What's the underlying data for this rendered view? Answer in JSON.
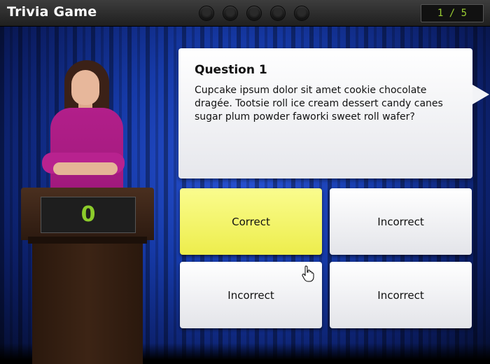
{
  "header": {
    "title": "Trivia Game",
    "progress_dots": 5,
    "counter": "1 / 5"
  },
  "podium": {
    "score": "0"
  },
  "question": {
    "title": "Question 1",
    "text": "Cupcake ipsum dolor sit amet cookie chocolate dragée. Tootsie roll ice cream dessert candy canes sugar plum powder faworki sweet roll wafer?"
  },
  "answers": [
    {
      "label": "Correct",
      "state": "selected"
    },
    {
      "label": "Incorrect"
    },
    {
      "label": "Incorrect"
    },
    {
      "label": "Incorrect"
    }
  ],
  "colors": {
    "selected_answer": "#f3f36a",
    "score": "#8ccc2b",
    "curtain": "#163aa8"
  }
}
